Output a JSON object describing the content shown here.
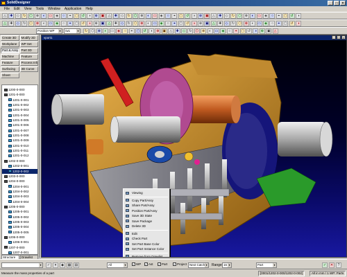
{
  "app": {
    "title": "SolidDesigner"
  },
  "menu": [
    "File",
    "Edit",
    "View",
    "Tools",
    "Window",
    "Application",
    "Help"
  ],
  "toolbar_combos": {
    "wp_dropdown": "Position WP",
    "wp_value": "/w1"
  },
  "modes": [
    "Create 3D",
    "Modify 3D",
    "Workplane",
    "WP Set",
    "Part & Assy",
    "Part 3D",
    "Machine",
    "Feature",
    "Feature",
    "Process Info",
    "Surfacing",
    "3D Curve",
    "Sheet"
  ],
  "active_mode": 4,
  "viewport": {
    "title": "vport1"
  },
  "tree": [
    {
      "label": "1200-0-000",
      "kind": "asm"
    },
    {
      "label": "1201-0-000",
      "kind": "asm"
    },
    {
      "label": "1201-0-001",
      "kind": "prt"
    },
    {
      "label": "1201-0-002",
      "kind": "prt"
    },
    {
      "label": "1201-0-003",
      "kind": "prt"
    },
    {
      "label": "1201-0-004",
      "kind": "prt"
    },
    {
      "label": "1201-0-005",
      "kind": "prt"
    },
    {
      "label": "1201-0-006",
      "kind": "prt"
    },
    {
      "label": "1201-0-007",
      "kind": "prt"
    },
    {
      "label": "1201-0-008",
      "kind": "prt"
    },
    {
      "label": "1201-0-009",
      "kind": "prt"
    },
    {
      "label": "1201-0-010",
      "kind": "prt"
    },
    {
      "label": "1201-0-011",
      "kind": "prt"
    },
    {
      "label": "1201-0-012",
      "kind": "prt"
    },
    {
      "label": "1202-0-000",
      "kind": "asm"
    },
    {
      "label": "1202-0-001",
      "kind": "prt"
    },
    {
      "label": "1202-0-002",
      "kind": "prt",
      "selected": true
    },
    {
      "label": "1203-0-000",
      "kind": "asm"
    },
    {
      "label": "1204-0-000",
      "kind": "asm"
    },
    {
      "label": "1204-0-001",
      "kind": "prt"
    },
    {
      "label": "1204-0-002",
      "kind": "prt"
    },
    {
      "label": "1204-0-003",
      "kind": "prt"
    },
    {
      "label": "1204-0-004",
      "kind": "prt"
    },
    {
      "label": "1205-0-000",
      "kind": "asm"
    },
    {
      "label": "1205-0-001",
      "kind": "prt"
    },
    {
      "label": "1205-0-002",
      "kind": "prt"
    },
    {
      "label": "1205-0-003",
      "kind": "prt"
    },
    {
      "label": "1205-0-004",
      "kind": "prt"
    },
    {
      "label": "1205-0-005",
      "kind": "prt"
    },
    {
      "label": "1206-0-000",
      "kind": "asm"
    },
    {
      "label": "1206-0-001",
      "kind": "prt"
    },
    {
      "label": "1207-0-000",
      "kind": "asm"
    },
    {
      "label": "1207-0-001",
      "kind": "prt"
    },
    {
      "label": "1207-0-002",
      "kind": "prt"
    },
    {
      "label": "1207-0-003",
      "kind": "prt"
    }
  ],
  "tree_tabs": [
    "Structure",
    "Drawlist"
  ],
  "context_menu": [
    {
      "label": "Viewing",
      "sep_after": true
    },
    {
      "label": "Copy Part/Assy"
    },
    {
      "label": "Share Part/Assy"
    },
    {
      "label": "Position Part/Assy"
    },
    {
      "label": "Save 3D State"
    },
    {
      "label": "Save Package"
    },
    {
      "label": "Delete 3D",
      "sep_after": true
    },
    {
      "label": "Edit"
    },
    {
      "label": "Check Part"
    },
    {
      "label": "Set Part Base Color"
    },
    {
      "label": "Set Part Instance Color",
      "sep_after": true
    },
    {
      "label": "Remove from Drawlist",
      "sep_after": true
    },
    {
      "label": "Part Mass Properties",
      "highlighted": true
    }
  ],
  "bottom_toolbar": {
    "view_combo": "All",
    "checks": [
      "WP",
      "Ast",
      "Part",
      "Project"
    ],
    "find_combo": "Next Catch",
    "range_label": "Range",
    "range_value": "16",
    "select_combo": "Part"
  },
  "status": {
    "message": "Measure the mass properties of a part",
    "coords": "[0001/1202-0-000/1202-0-002]",
    "units": "All in mm / 1 WP: Parts"
  }
}
